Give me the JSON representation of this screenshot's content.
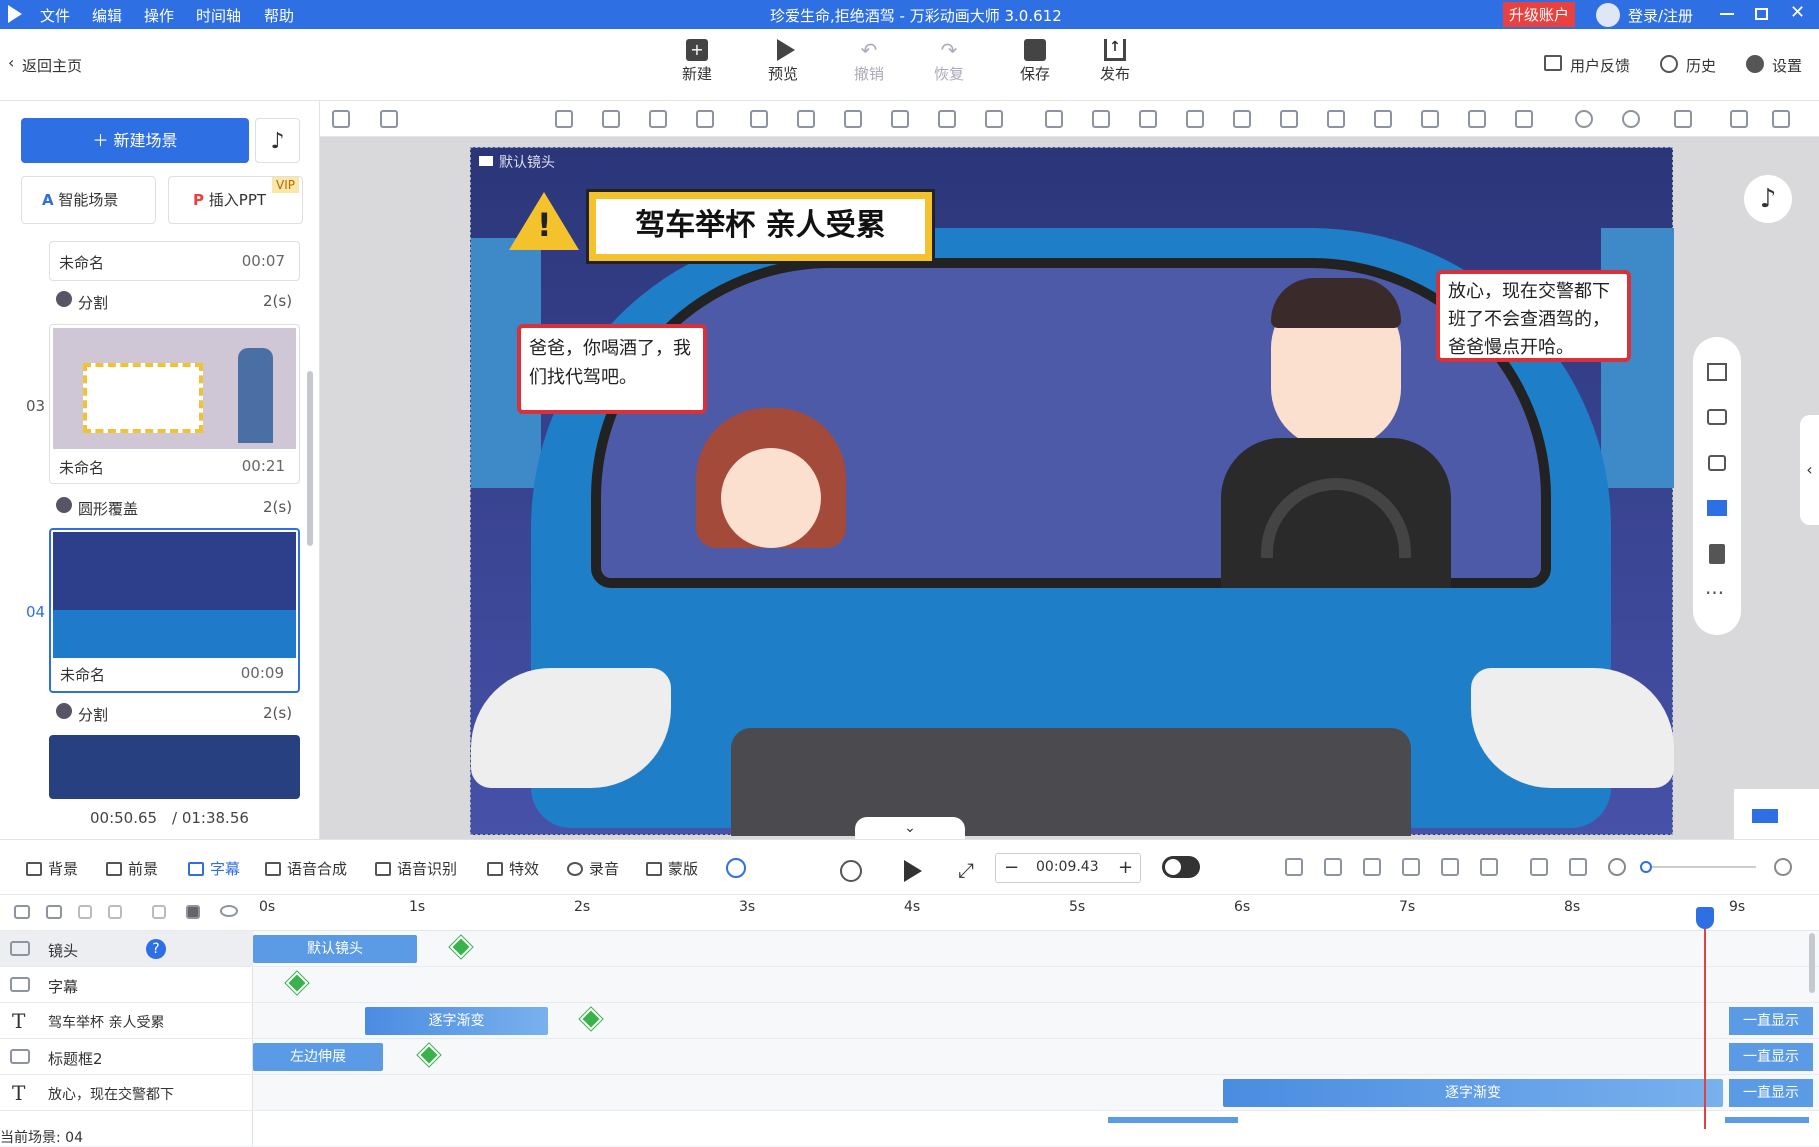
{
  "titlebar": {
    "menus": [
      "文件",
      "编辑",
      "操作",
      "时间轴",
      "帮助"
    ],
    "title": "珍爱生命,拒绝酒驾 - 万彩动画大师 3.0.612",
    "upgrade": "升级账户",
    "login": "登录/注册"
  },
  "toolbar": {
    "back": "返回主页",
    "new": "新建",
    "preview": "预览",
    "undo": "撤销",
    "redo": "恢复",
    "save": "保存",
    "publish": "发布",
    "feedback": "用户反馈",
    "history": "历史",
    "settings": "设置"
  },
  "sidebar": {
    "new_scene": "新建场景",
    "smart_scene": "智能场景",
    "insert_ppt": "插入PPT",
    "vip": "VIP",
    "scenes": [
      {
        "name": "未命名",
        "duration": "00:07",
        "number": ""
      },
      {
        "transition": "分割",
        "trans_dur": "2(s)"
      },
      {
        "name": "未命名",
        "duration": "00:21",
        "number": "03"
      },
      {
        "transition": "圆形覆盖",
        "trans_dur": "2(s)"
      },
      {
        "name": "未命名",
        "duration": "00:09",
        "number": "04"
      },
      {
        "transition": "分割",
        "trans_dur": "2(s)"
      }
    ],
    "time_current": "00:50.65",
    "time_total": "/ 01:38.56"
  },
  "stage": {
    "camera_label": "默认镜头",
    "banner": "驾车举杯 亲人受累",
    "bubble_left": "爸爸，你喝酒了，我们找代驾吧。",
    "bubble_right": "放心，现在交警都下班了不会查酒驾的，爸爸慢点开哈。"
  },
  "timeline_toolbar": {
    "items": [
      "背景",
      "前景",
      "字幕",
      "语音合成",
      "语音识别",
      "特效",
      "录音",
      "蒙版"
    ],
    "time": "00:09.43"
  },
  "timeline": {
    "ruler": [
      "0s",
      "1s",
      "2s",
      "3s",
      "4s",
      "5s",
      "6s",
      "7s",
      "8s",
      "9s"
    ],
    "tracks": [
      {
        "name": "镜头",
        "clip": "默认镜头"
      },
      {
        "name": "字幕",
        "clip": ""
      },
      {
        "name": "驾车举杯 亲人受累",
        "clip": "逐字渐变",
        "always": "一直显示"
      },
      {
        "name": "标题框2",
        "clip": "左边伸展",
        "always": "一直显示"
      },
      {
        "name": "放心，现在交警都下",
        "clip": "逐字渐变",
        "always": "一直显示"
      }
    ],
    "current_scene": "当前场景: 04"
  },
  "colors": {
    "accent": "#2e6fe3",
    "upgrade": "#e9413f",
    "clip": "#5b9be6",
    "key": "#38b24a"
  }
}
